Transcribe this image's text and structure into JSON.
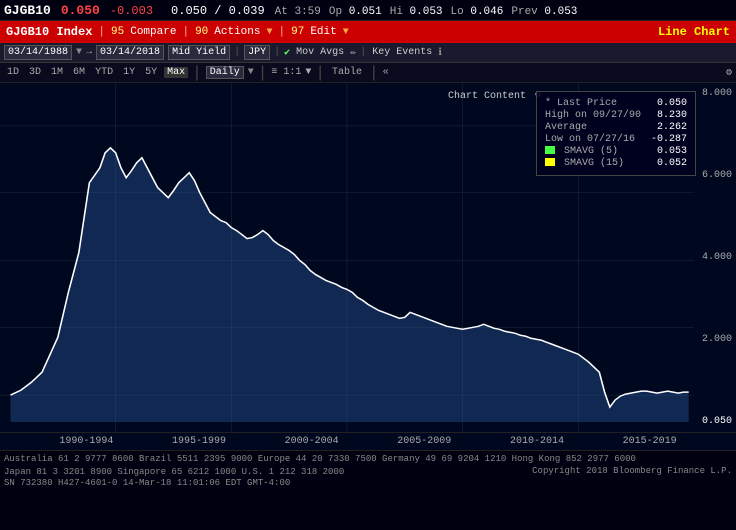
{
  "header": {
    "ticker": "GJGB10",
    "price": "0.050",
    "change": "-0.003",
    "bid_ask": "0.050 / 0.039",
    "at_time": "At 3:59",
    "open_label": "Op",
    "open_val": "0.051",
    "high_label": "Hi",
    "high_val": "0.053",
    "low_label": "Lo",
    "low_val": "0.046",
    "prev_label": "Prev",
    "prev_val": "0.053"
  },
  "toolbar": {
    "index_label": "GJGB10 Index",
    "compare_num": "95",
    "compare_label": "Compare",
    "actions_num": "90",
    "actions_label": "Actions",
    "edit_num": "97",
    "edit_label": "Edit",
    "line_chart_label": "Line Chart"
  },
  "options_bar": {
    "date_from": "03/14/1988",
    "date_to": "03/14/2018",
    "mid_yield": "Mid Yield",
    "currency": "JPY",
    "mov_avgs": "Mov Avgs",
    "key_events": "Key Events",
    "chart_content": "Chart Content"
  },
  "period_bar": {
    "periods": [
      "1D",
      "3D",
      "1M",
      "6M",
      "YTD",
      "1Y",
      "5Y",
      "Max"
    ],
    "freq": "Daily",
    "active_period": "Max",
    "table_label": "Table"
  },
  "legend": {
    "last_price_label": "* Last Price",
    "last_price_val": "0.050",
    "high_label": "High on 09/27/90",
    "high_val": "8.230",
    "avg_label": "Average",
    "avg_val": "2.262",
    "low_label": "Low on 07/27/16",
    "low_val": "-0.287",
    "smavg5_label": "SMAVG (5)",
    "smavg5_val": "0.053",
    "smavg5_color": "#44ff44",
    "smavg15_label": "SMAVG (15)",
    "smavg15_val": "0.052",
    "smavg15_color": "#ffff00"
  },
  "y_axis": {
    "labels": [
      "8.000",
      "6.000",
      "4.000",
      "2.000",
      "0.050"
    ]
  },
  "x_axis": {
    "labels": [
      "1990-1994",
      "1995-1999",
      "2000-2004",
      "2005-2009",
      "2010-2014",
      "2015-2019"
    ]
  },
  "footer": {
    "line1": "Australia 61 2 9777 8600  Brazil 5511 2395 9000  Europe 44 20 7330 7500  Germany 49 69 9204 1210  Hong Kong 852 2977 6000",
    "line2": "Japan 81 3 3201 8900  Singapore 65 6212 1000  U.S. 1 212 318 2000",
    "copyright": "Copyright 2018 Bloomberg Finance L.P.",
    "sn": "SN 732380 H427-4601-0 14-Mar-18 11:01:06 EDT  GMT-4:00"
  },
  "colors": {
    "background": "#000010",
    "toolbar_bg": "#cc0000",
    "chart_bg": "#000820",
    "line_color": "#ffffff",
    "grid_color": "#1a2a3a",
    "accent": "#ffff00"
  }
}
